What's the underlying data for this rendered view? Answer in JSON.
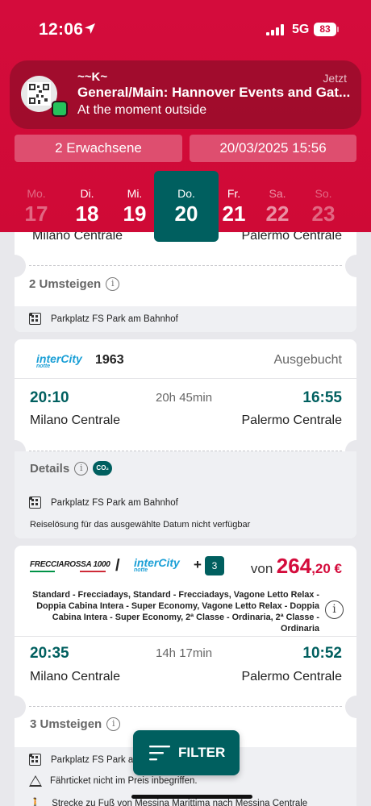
{
  "status_bar": {
    "time": "12:06",
    "network": "5G",
    "battery": "83"
  },
  "notification": {
    "sender": "~~K~",
    "time": "Jetzt",
    "title": "General/Main: Hannover Events and Gat...",
    "body": "At the moment outside"
  },
  "search": {
    "passengers": "2 Erwachsene",
    "datetime": "20/03/2025 15:56"
  },
  "days": [
    {
      "name": "Mo.",
      "num": "17"
    },
    {
      "name": "Di.",
      "num": "18"
    },
    {
      "name": "Mi.",
      "num": "19"
    },
    {
      "name": "Do.",
      "num": "20"
    },
    {
      "name": "Fr.",
      "num": "21"
    },
    {
      "name": "Sa.",
      "num": "22"
    },
    {
      "name": "So.",
      "num": "23"
    }
  ],
  "card1": {
    "from": "Milano Centrale",
    "to": "Palermo Centrale",
    "changes": "2 Umsteigen",
    "parking": "Parkplatz FS Park am Bahnhof"
  },
  "card2": {
    "brand": "interCity",
    "brand_sub": "notte",
    "train_number": "1963",
    "status": "Ausgebucht",
    "dep_time": "20:10",
    "duration": "20h 45min",
    "arr_time": "16:55",
    "from": "Milano Centrale",
    "to": "Palermo Centrale",
    "details": "Details",
    "co2": "CO₂",
    "parking": "Parkplatz FS Park am Bahnhof",
    "unavailable": "Reiselösung für das ausgewählte Datum nicht verfügbar"
  },
  "card3": {
    "brand1": "FRECCIAROSSA 1000",
    "separator": "/",
    "brand2": "interCity",
    "brand2_sub": "notte",
    "plus": "+",
    "extra_count": "3",
    "price_prefix": "von",
    "price_main": "264",
    "price_cents": ",20 €",
    "classes": "Standard - Frecciadays, Standard - Frecciadays, Vagone Letto Relax - Doppia Cabina Intera - Super Economy, Vagone Letto Relax - Doppia Cabina Intera - Super Economy, 2ª Classe - Ordinaria, 2ª Classe - Ordinaria",
    "dep_time": "20:35",
    "duration": "14h 17min",
    "arr_time": "10:52",
    "from": "Milano Centrale",
    "to": "Palermo Centrale",
    "changes": "3 Umsteigen",
    "parking": "Parkplatz FS Park am Bahnhof",
    "ticket_note": "Fährticket nicht im Preis inbegriffen.",
    "walk_note": "Strecke zu Fuß von Messina Marittima nach Messina Centrale"
  },
  "filter": {
    "label": "FILTER"
  },
  "colors": {
    "brand_red": "#d40c3c",
    "teal": "#005f5f",
    "price_red": "#d40c3c"
  }
}
